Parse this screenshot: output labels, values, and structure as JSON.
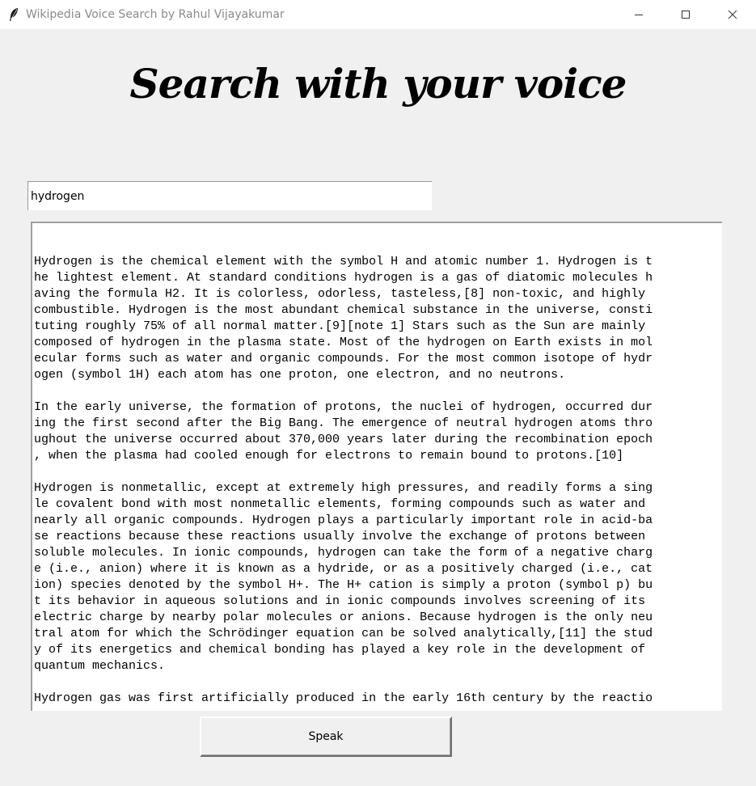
{
  "window": {
    "title": "Wikipedia Voice Search by Rahul Vijayakumar",
    "icon": "feather-icon",
    "controls": [
      "minimize-icon",
      "maximize-icon",
      "close-icon"
    ]
  },
  "heading": "Search with your voice",
  "search": {
    "value": "hydrogen"
  },
  "result": {
    "lines": [
      "Hydrogen is the chemical element with the symbol H and atomic number 1. Hydrogen is t",
      "he lightest element. At standard conditions hydrogen is a gas of diatomic molecules h",
      "aving the formula H2. It is colorless, odorless, tasteless,[8] non-toxic, and highly",
      "combustible. Hydrogen is the most abundant chemical substance in the universe, consti",
      "tuting roughly 75% of all normal matter.[9][note 1] Stars such as the Sun are mainly",
      "composed of hydrogen in the plasma state. Most of the hydrogen on Earth exists in mol",
      "ecular forms such as water and organic compounds. For the most common isotope of hydr",
      "ogen (symbol 1H) each atom has one proton, one electron, and no neutrons.",
      "",
      "In the early universe, the formation of protons, the nuclei of hydrogen, occurred dur",
      "ing the first second after the Big Bang. The emergence of neutral hydrogen atoms thro",
      "ughout the universe occurred about 370,000 years later during the recombination epoch",
      ", when the plasma had cooled enough for electrons to remain bound to protons.[10]",
      "",
      "Hydrogen is nonmetallic, except at extremely high pressures, and readily forms a sing",
      "le covalent bond with most nonmetallic elements, forming compounds such as water and",
      "nearly all organic compounds. Hydrogen plays a particularly important role in acid-ba",
      "se reactions because these reactions usually involve the exchange of protons between",
      "soluble molecules. In ionic compounds, hydrogen can take the form of a negative charg",
      "e (i.e., anion) where it is known as a hydride, or as a positively charged (i.e., cat",
      "ion) species denoted by the symbol H+. The H+ cation is simply a proton (symbol p) bu",
      "t its behavior in aqueous solutions and in ionic compounds involves screening of its",
      "electric charge by nearby polar molecules or anions. Because hydrogen is the only neu",
      "tral atom for which the Schrödinger equation can be solved analytically,[11] the stud",
      "y of its energetics and chemical bonding has played a key role in the development of",
      "quantum mechanics.",
      "",
      "Hydrogen gas was first artificially produced in the early 16th century by the reactio"
    ]
  },
  "speak_button": {
    "label": "Speak"
  }
}
